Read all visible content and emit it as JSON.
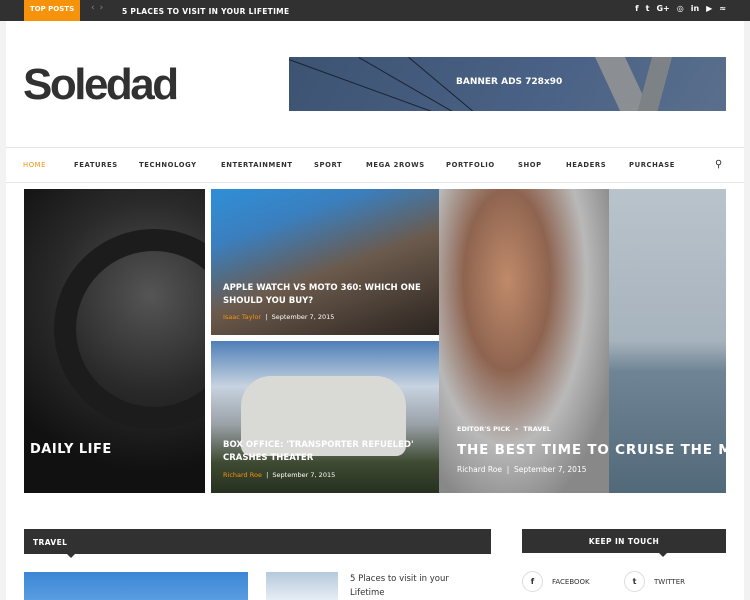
{
  "topbar": {
    "label": "TOP POSTS",
    "prev": "‹",
    "next": "›",
    "ticker": "5 PLACES TO VISIT IN YOUR LIFETIME",
    "social": [
      {
        "icon": "facebook-icon",
        "glyph": "f"
      },
      {
        "icon": "twitter-icon",
        "glyph": "t"
      },
      {
        "icon": "google-plus-icon",
        "glyph": "G+"
      },
      {
        "icon": "instagram-icon",
        "glyph": "◎"
      },
      {
        "icon": "linkedin-icon",
        "glyph": "in"
      },
      {
        "icon": "youtube-icon",
        "glyph": "▶"
      },
      {
        "icon": "rss-icon",
        "glyph": "≈"
      }
    ]
  },
  "logo": "Soledad",
  "banner": "BANNER ADS 728x90",
  "nav": [
    "HOME",
    "FEATURES",
    "TECHNOLOGY",
    "ENTERTAINMENT",
    "SPORT",
    "MEGA 2ROWS",
    "PORTFOLIO",
    "SHOP",
    "HEADERS",
    "PURCHASE"
  ],
  "accent": "#f7930a",
  "featured": {
    "left": {
      "title": "DAILY LIFE"
    },
    "mid1": {
      "title": "APPLE WATCH VS MOTO 360: WHICH ONE SHOULD YOU BUY?",
      "author": "Isaac Taylor",
      "date": "September 7, 2015"
    },
    "mid2": {
      "title": "BOX OFFICE: 'TRANSPORTER REFUELED' CRASHES THEATER",
      "author": "Richard Roe",
      "date": "September 7, 2015"
    },
    "right": {
      "cat1": "EDITOR'S PICK",
      "cat2": "TRAVEL",
      "title": "THE BEST TIME TO CRUISE THE MEDITERRANEAN",
      "author": "Richard Roe",
      "date": "September 7, 2015"
    }
  },
  "travel": {
    "heading": "TRAVEL",
    "post_title": "5 Places to visit in your Lifetime"
  },
  "sidebar": {
    "heading": "KEEP IN TOUCH",
    "facebook": "FACEBOOK",
    "twitter": "TWITTER"
  }
}
